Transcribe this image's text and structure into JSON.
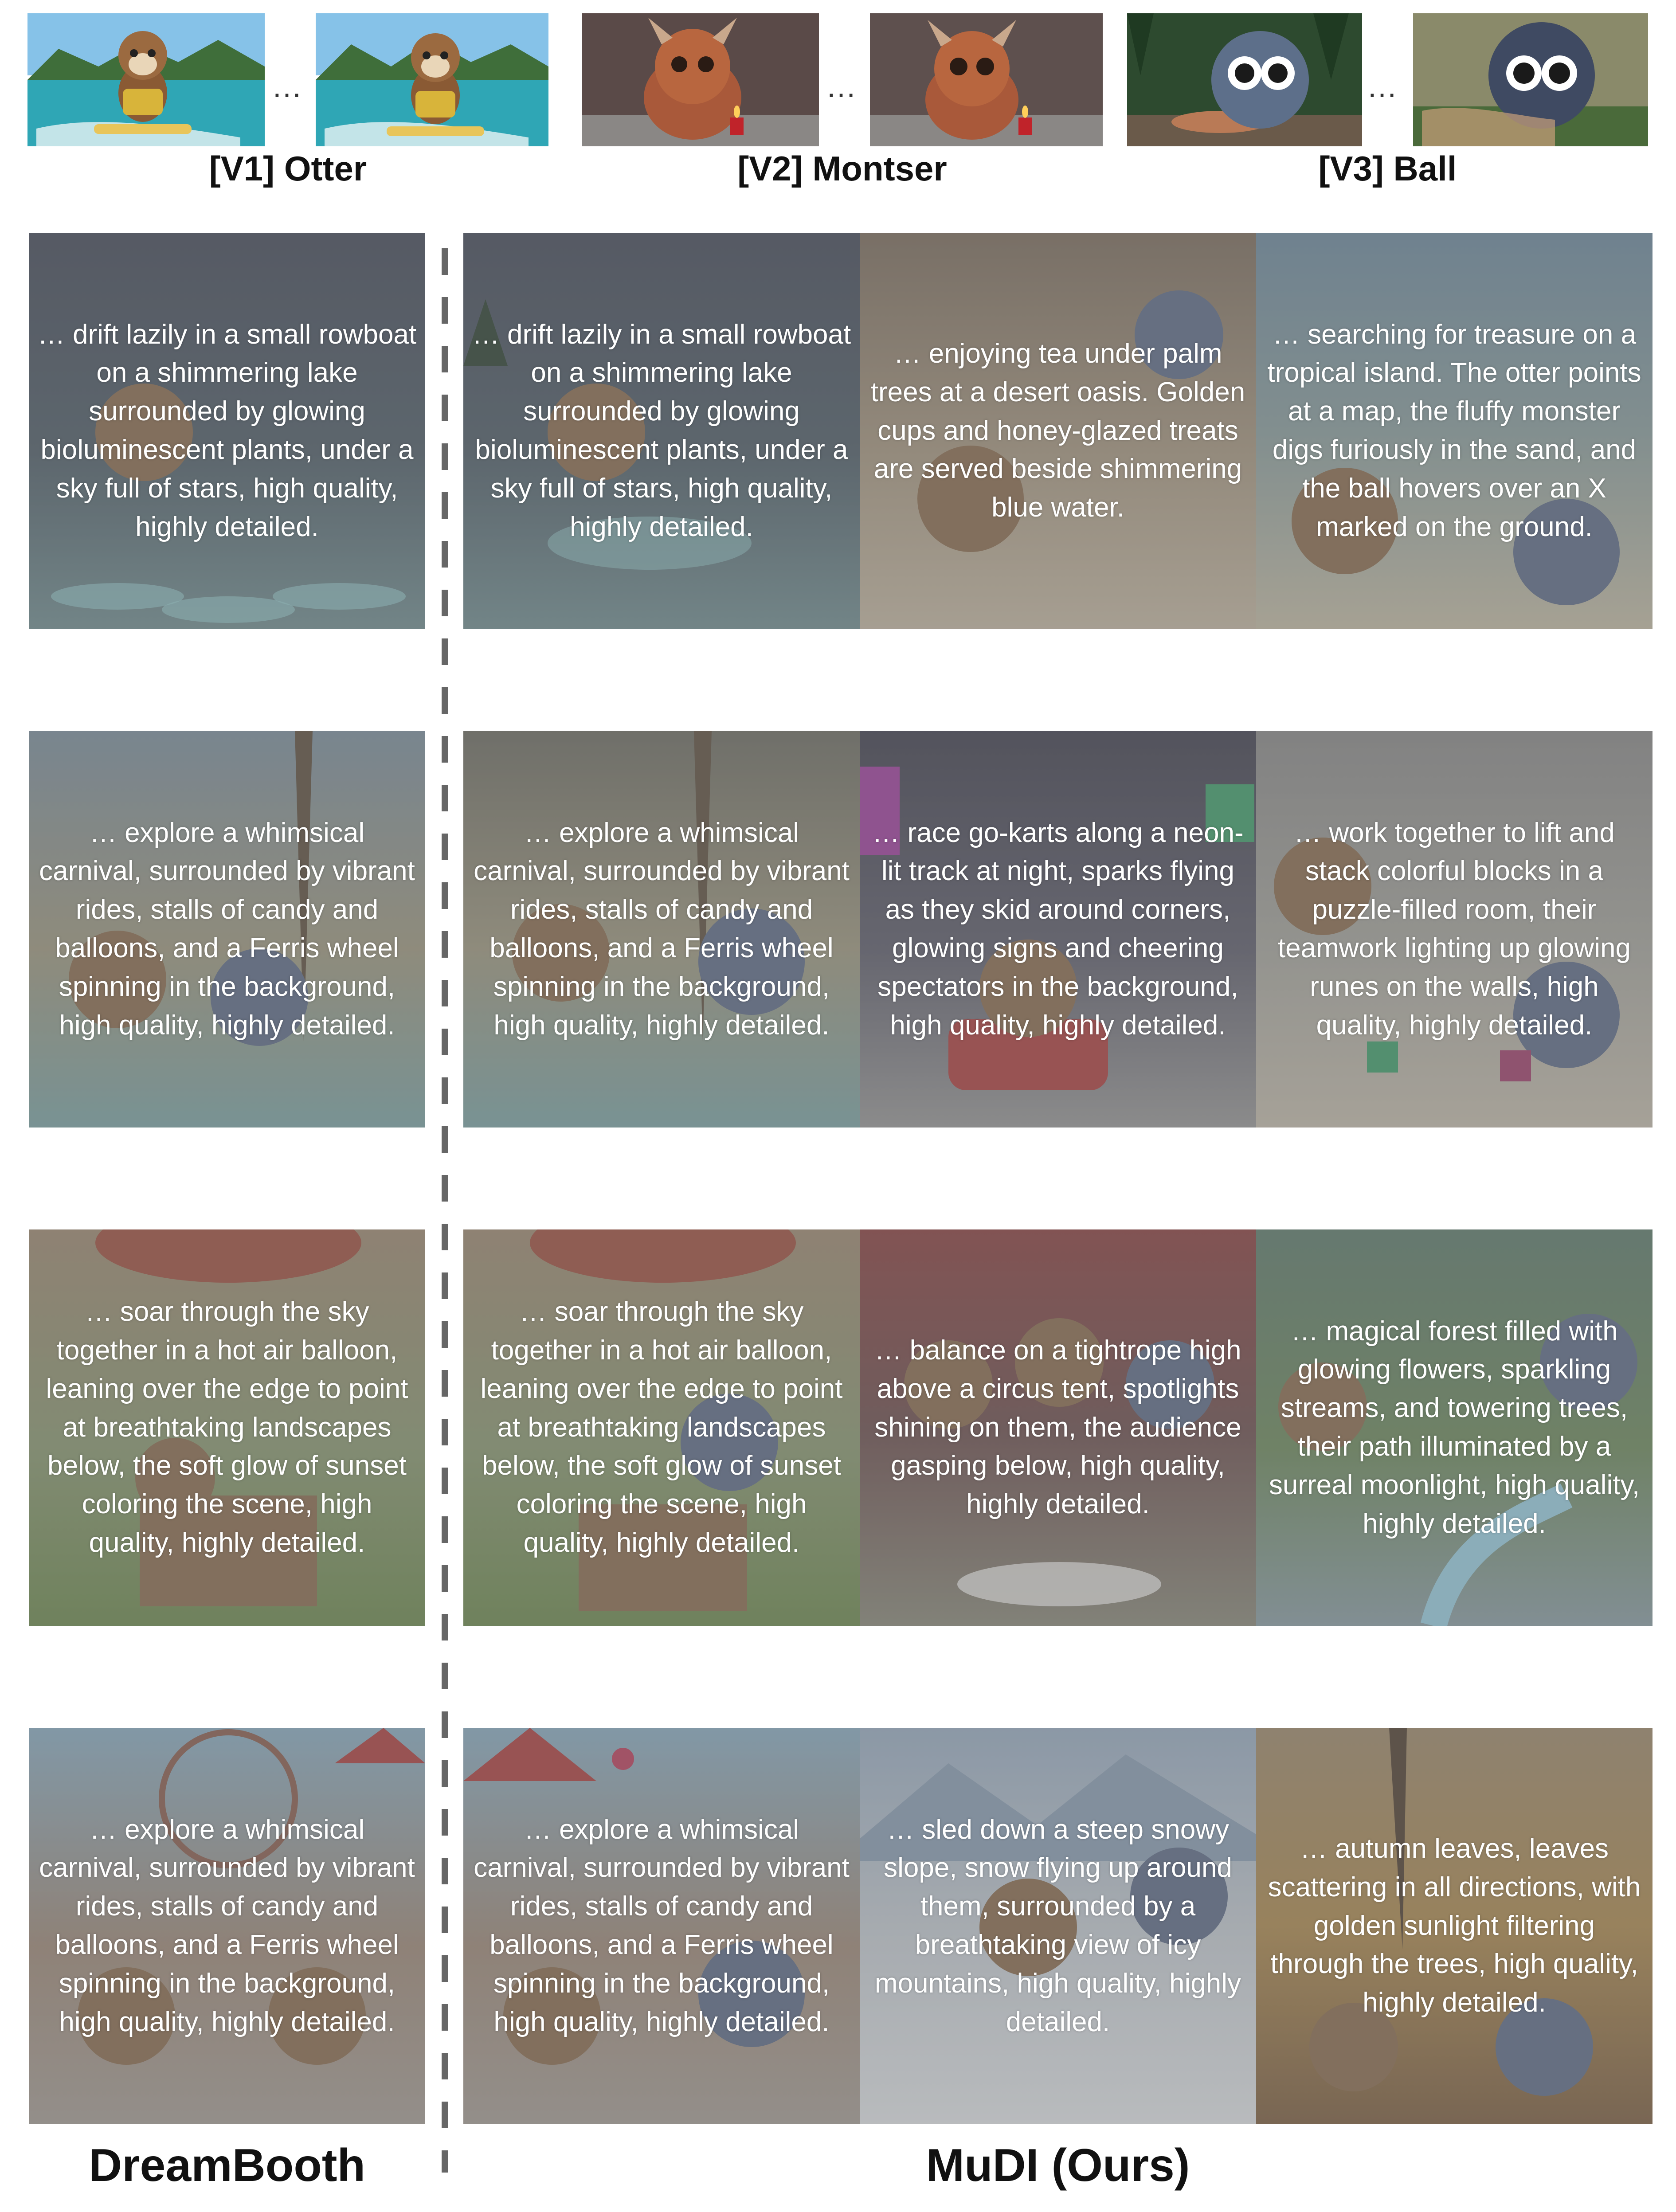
{
  "references": [
    {
      "label": "[V1] Otter",
      "dots": "…"
    },
    {
      "label": "[V2] Montser",
      "dots": "…"
    },
    {
      "label": "[V3] Ball",
      "dots": "…"
    }
  ],
  "methods": {
    "baseline": "DreamBooth",
    "ours": "MuDI (Ours)"
  },
  "captions": {
    "r0_baseline": "… drift lazily in a small rowboat on a shimmering lake surrounded by glowing bioluminescent plants, under a sky full of stars, high quality, highly detailed.",
    "r0_c1": "… drift lazily in a small rowboat on a shimmering lake surrounded by glowing bioluminescent plants, under a sky full of stars, high quality, highly detailed.",
    "r0_c2": "… enjoying tea under palm trees at a desert oasis. Golden cups and honey-glazed treats are served beside shimmering blue water.",
    "r0_c3": "… searching for treasure on a tropical island. The otter points at a map, the fluffy monster digs furiously in the sand, and the ball hovers over an X marked on the ground.",
    "r1_baseline": "… explore a whimsical carnival, surrounded by vibrant rides, stalls of candy and balloons, and a Ferris wheel spinning in the background, high quality, highly detailed.",
    "r1_c1": "… explore a whimsical carnival, surrounded by vibrant rides, stalls of candy and balloons, and a Ferris wheel spinning in the background, high quality, highly detailed.",
    "r1_c2": "… race go-karts along a neon-lit track at night, sparks flying as they skid around corners, glowing signs and cheering spectators in the background, high quality, highly detailed.",
    "r1_c3": "… work together to lift and stack colorful blocks in a puzzle-filled room, their teamwork lighting up glowing runes on the walls, high quality, highly detailed.",
    "r2_baseline": "… soar through the sky together in a hot air balloon, leaning over the edge to point at breathtaking landscapes below, the soft glow of sunset coloring the scene, high quality, highly detailed.",
    "r2_c1": "… soar through the sky together in a hot air balloon, leaning over the edge to point at breathtaking landscapes below, the soft glow of sunset coloring the scene, high quality, highly detailed.",
    "r2_c2": "… balance on a tightrope high above a circus tent, spotlights shining on them, the audience gasping below, high quality, highly detailed.",
    "r2_c3": "… magical forest filled with glowing flowers, sparkling streams, and towering trees, their path illuminated by a surreal moonlight, high quality, highly detailed.",
    "r3_baseline": "… explore a whimsical carnival, surrounded by vibrant rides, stalls of candy and balloons, and a Ferris wheel spinning in the background, high quality, highly detailed.",
    "r3_c1": "… explore a whimsical carnival, surrounded by vibrant rides, stalls of candy and balloons, and a Ferris wheel spinning in the background, high quality, highly detailed.",
    "r3_c2": "… sled down a steep snowy slope, snow flying up around them, surrounded by a breathtaking view of icy mountains, high quality, highly detailed.",
    "r3_c3": "… autumn leaves, leaves scattering in all directions, with golden sunlight filtering through the trees, high quality, highly detailed."
  }
}
